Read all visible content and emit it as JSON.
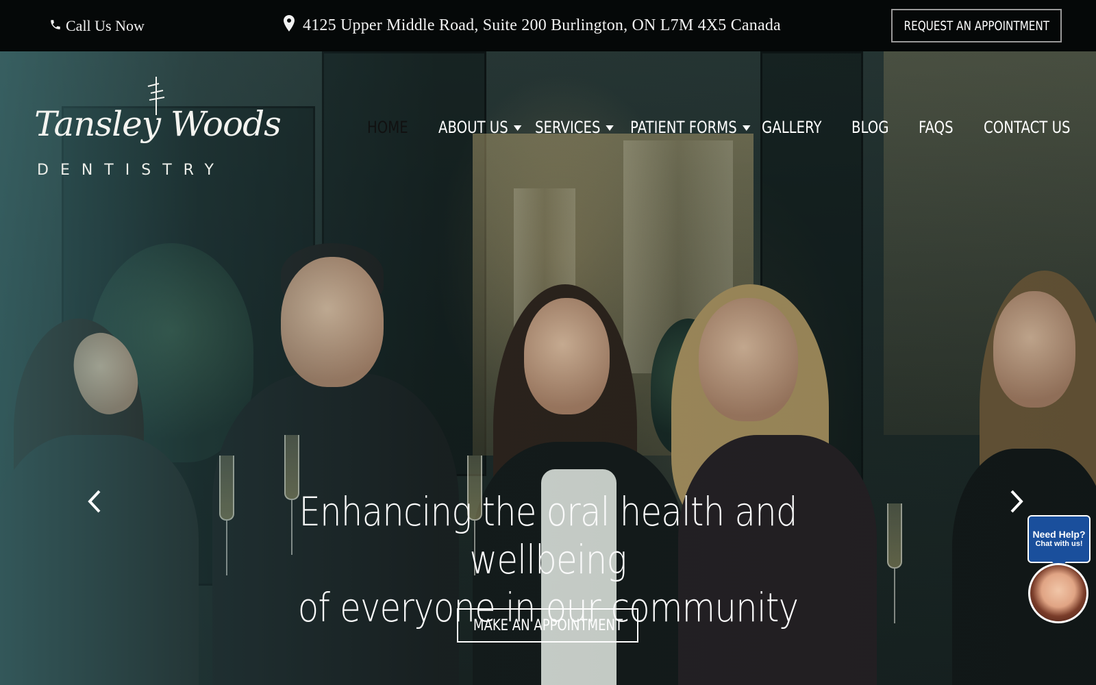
{
  "topbar": {
    "call_label": "Call Us Now",
    "call_icon": "phone-icon",
    "address": "4125 Upper Middle Road, Suite 200 Burlington, ON L7M 4X5 Canada",
    "address_icon": "map-pin-icon",
    "request_button": "REQUEST AN APPOINTMENT"
  },
  "logo": {
    "script": "Tansley Woods",
    "sub": "DENTISTRY"
  },
  "nav": {
    "items": [
      {
        "label": "HOME",
        "active": true,
        "dropdown": false
      },
      {
        "label": "ABOUT US",
        "active": false,
        "dropdown": true
      },
      {
        "label": "SERVICES",
        "active": false,
        "dropdown": true
      },
      {
        "label": "PATIENT FORMS",
        "active": false,
        "dropdown": true
      },
      {
        "label": "GALLERY",
        "active": false,
        "dropdown": false
      },
      {
        "label": "BLOG",
        "active": false,
        "dropdown": false
      },
      {
        "label": "FAQS",
        "active": false,
        "dropdown": false
      },
      {
        "label": "CONTACT US",
        "active": false,
        "dropdown": false
      }
    ]
  },
  "hero": {
    "headline_line1": "Enhancing the oral health and wellbeing",
    "headline_line2": "of everyone in our community",
    "cta": "MAKE AN APPOINTMENT",
    "prev_icon": "chevron-left-icon",
    "next_icon": "chevron-right-icon"
  },
  "chat": {
    "line1": "Need Help?",
    "line2": "Chat with us!"
  },
  "colors": {
    "topbar_bg": "#050808",
    "chat_blue": "#1a4f9c",
    "overlay_teal": "#46828a"
  }
}
